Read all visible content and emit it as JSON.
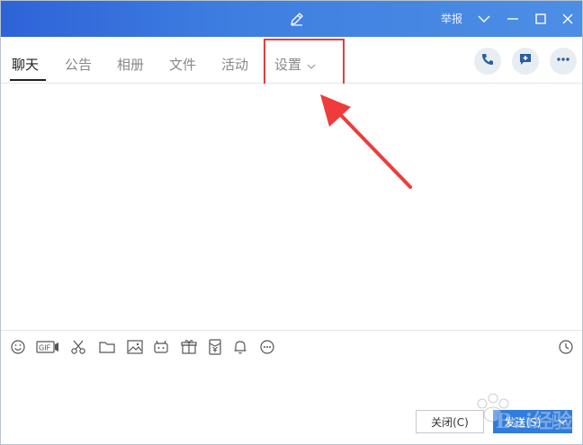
{
  "titlebar": {
    "report_label": "举报"
  },
  "tabs": [
    {
      "label": "聊天"
    },
    {
      "label": "公告"
    },
    {
      "label": "相册"
    },
    {
      "label": "文件"
    },
    {
      "label": "活动"
    },
    {
      "label": "设置"
    }
  ],
  "input": {
    "value": ""
  },
  "buttons": {
    "close_label": "关闭(C)",
    "send_label": "发送(S)"
  },
  "watermark": {
    "text": "Bai经验"
  },
  "icons": {
    "title": [
      "edit-icon",
      "chevron-down-icon",
      "minimize-icon",
      "maximize-icon",
      "close-icon"
    ],
    "actions": [
      "phone-icon",
      "add-comment-icon",
      "more-icon"
    ],
    "toolbar": [
      "emoji-icon",
      "gif-icon",
      "scissors-icon",
      "folder-icon",
      "image-icon",
      "robot-icon",
      "gift-icon",
      "red-packet-icon",
      "bell-icon",
      "more-circle-icon",
      "history-clock-icon"
    ]
  },
  "colors": {
    "title_gradient_start": "#2e63d8",
    "title_gradient_end": "#4d8ee5",
    "send_button": "#2f7de1",
    "annotation_red": "#e83b3b"
  }
}
